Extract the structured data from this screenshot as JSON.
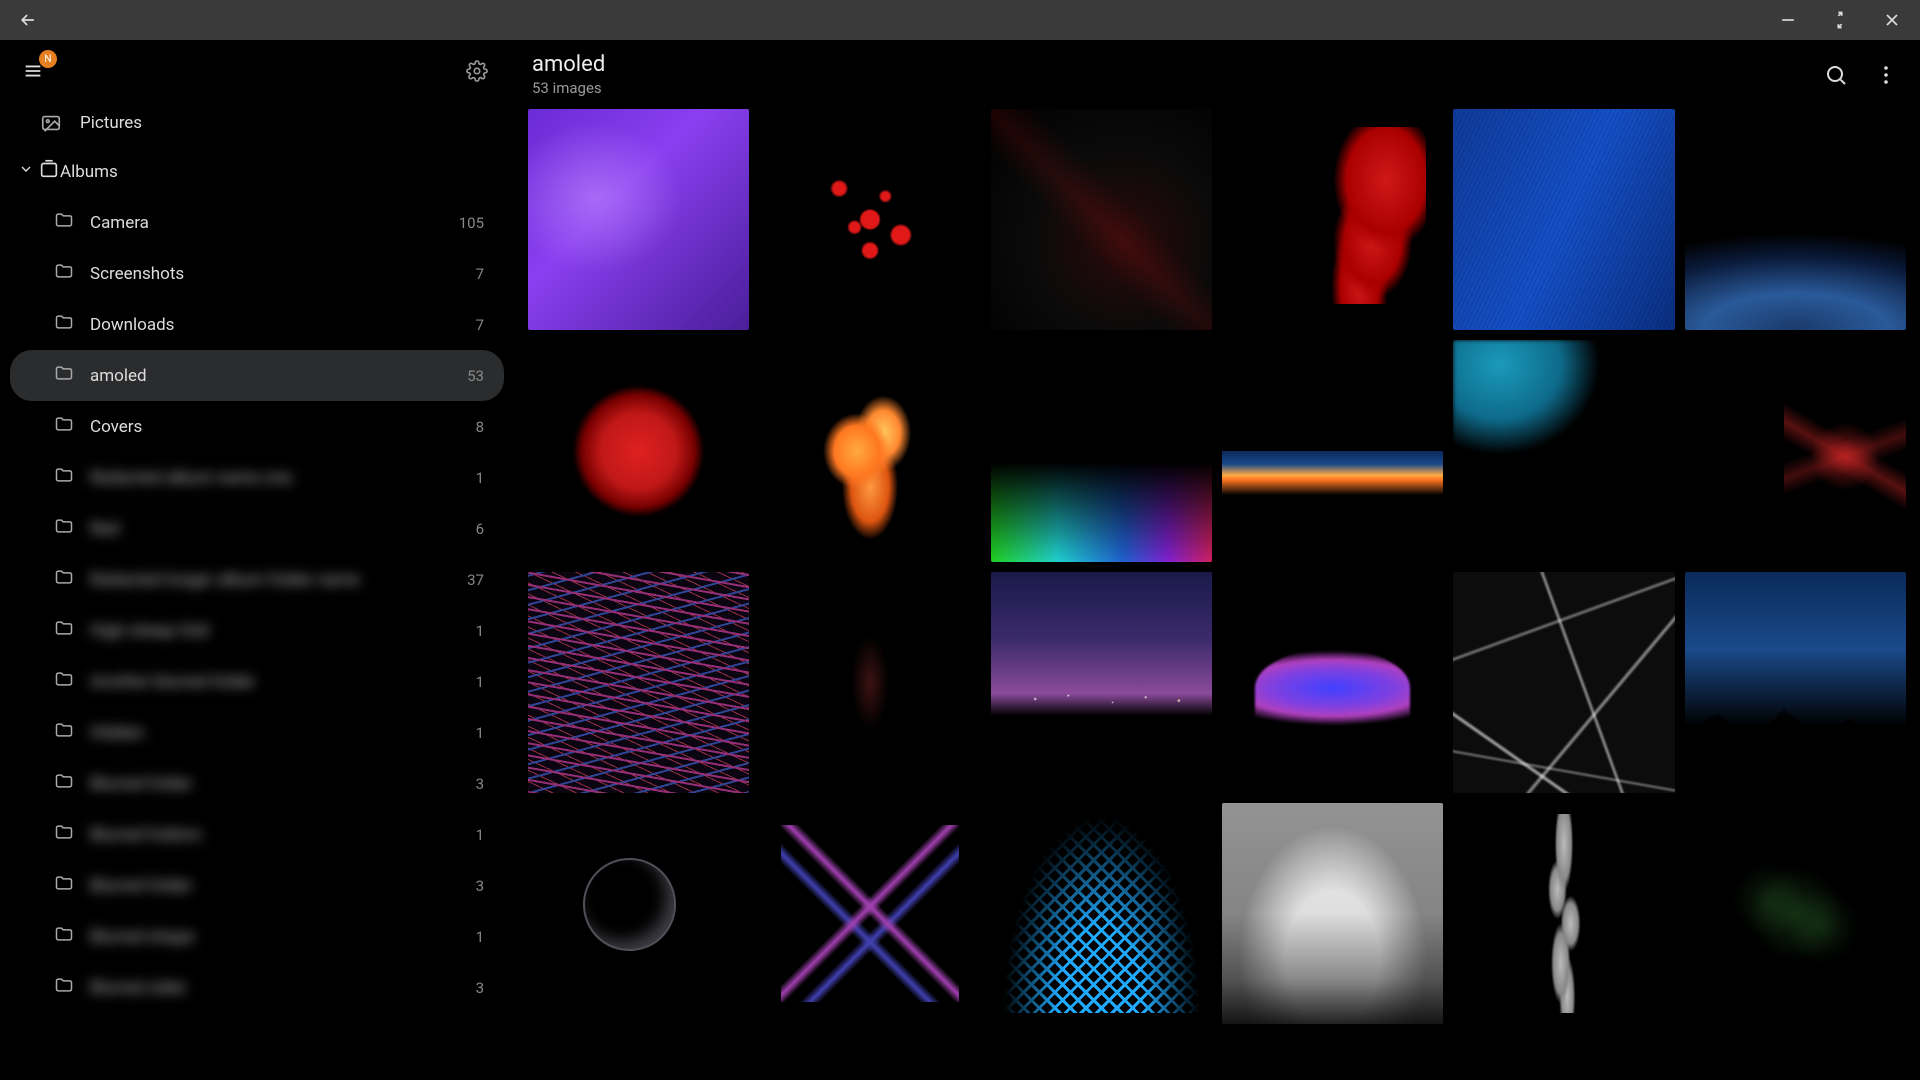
{
  "titlebar": {
    "badge": "N"
  },
  "sidebar": {
    "pictures_label": "Pictures",
    "albums_label": "Albums",
    "albums": [
      {
        "name": "Camera",
        "count": "105",
        "blurred": false,
        "active": false
      },
      {
        "name": "Screenshots",
        "count": "7",
        "blurred": false,
        "active": false
      },
      {
        "name": "Downloads",
        "count": "7",
        "blurred": false,
        "active": false
      },
      {
        "name": "amoled",
        "count": "53",
        "blurred": false,
        "active": true
      },
      {
        "name": "Covers",
        "count": "8",
        "blurred": false,
        "active": false
      },
      {
        "name": "Redacted album name one",
        "count": "1",
        "blurred": true,
        "active": false
      },
      {
        "name": "Red",
        "count": "6",
        "blurred": true,
        "active": false
      },
      {
        "name": "Redacted longer album folder name",
        "count": "37",
        "blurred": true,
        "active": false
      },
      {
        "name": "High sheep fold",
        "count": "1",
        "blurred": true,
        "active": false
      },
      {
        "name": "Another blurred folder",
        "count": "1",
        "blurred": true,
        "active": false
      },
      {
        "name": "Hidden",
        "count": "1",
        "blurred": true,
        "active": false
      },
      {
        "name": "Blurred folder",
        "count": "3",
        "blurred": true,
        "active": false
      },
      {
        "name": "Blurred foldnm",
        "count": "1",
        "blurred": true,
        "active": false
      },
      {
        "name": "Blurred folder",
        "count": "3",
        "blurred": true,
        "active": false
      },
      {
        "name": "Blurred shape",
        "count": "1",
        "blurred": true,
        "active": false
      },
      {
        "name": "Blurred older",
        "count": "3",
        "blurred": true,
        "active": false
      }
    ]
  },
  "main": {
    "title": "amoled",
    "subtitle": "53 images"
  }
}
